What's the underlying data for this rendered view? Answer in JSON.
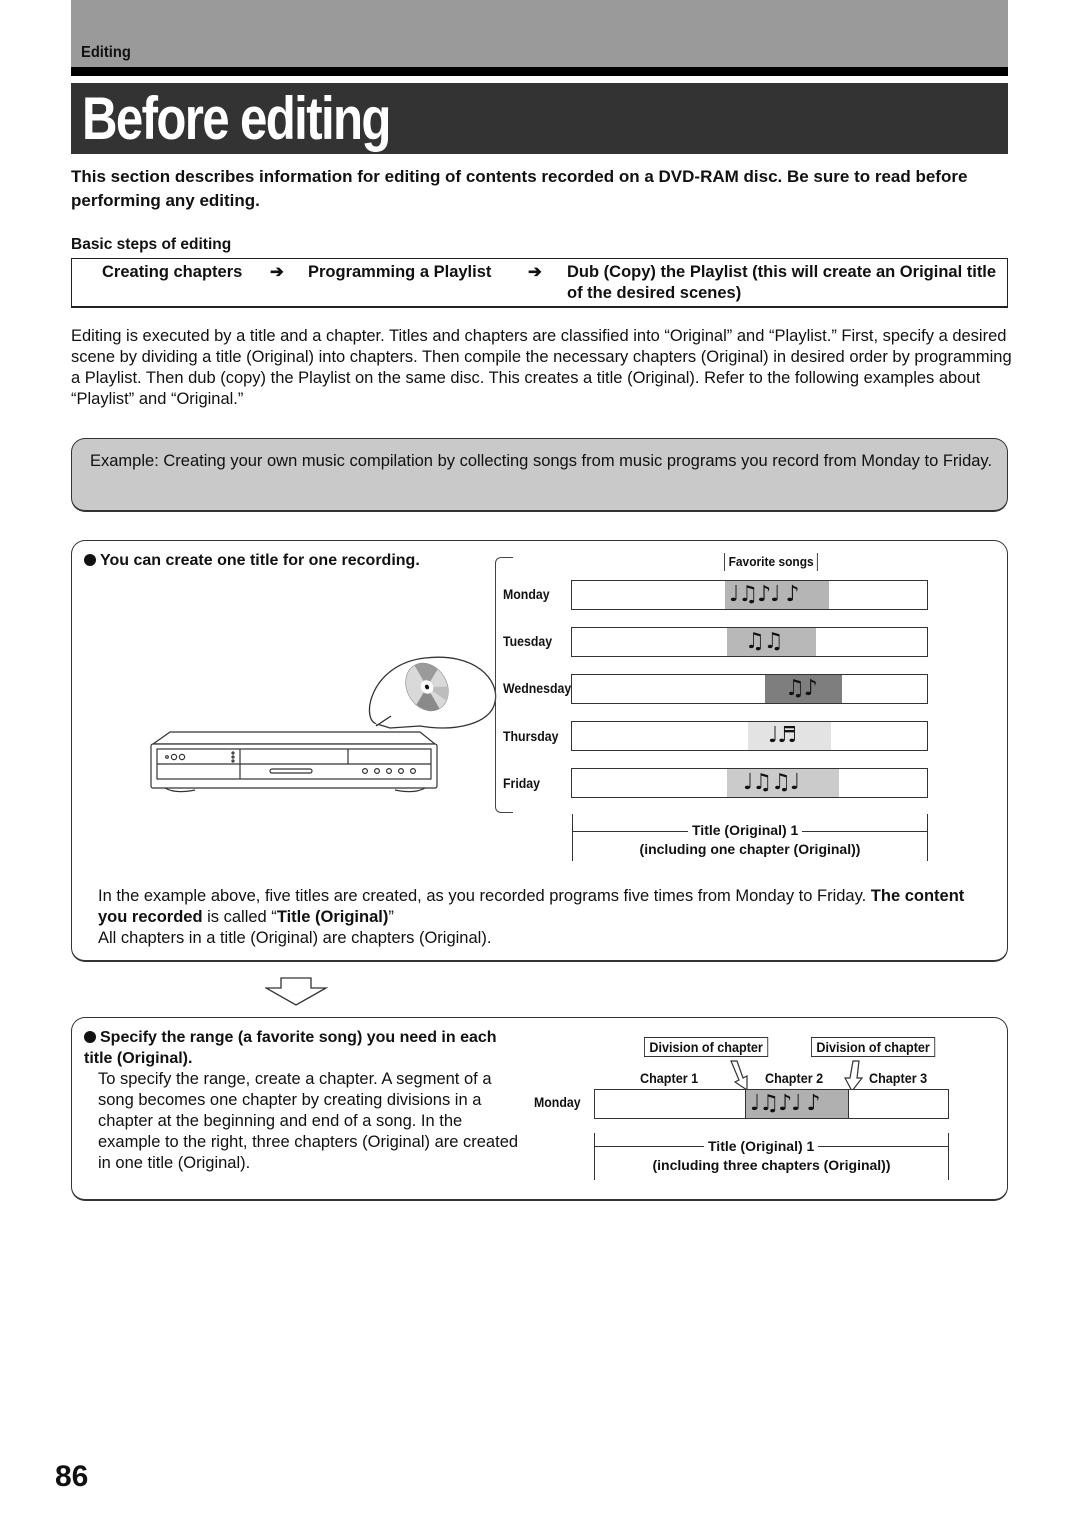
{
  "header": {
    "section": "Editing",
    "title": "Before editing"
  },
  "intro": "This section describes information for editing of contents recorded on a DVD-RAM disc. Be sure to read before performing any editing.",
  "basic_steps": {
    "heading": "Basic steps of editing",
    "steps": [
      "Creating chapters",
      "Programming a Playlist",
      "Dub (Copy) the Playlist (this will create an Original title of the desired scenes)"
    ],
    "arrow_glyph": "➔"
  },
  "body_paragraph": "Editing is executed by a title and a chapter. Titles and chapters are classified into “Original” and “Playlist.” First, specify a desired scene by dividing a title (Original) into chapters. Then compile the necessary chapters (Original) in desired order by programming a Playlist. Then dub (copy) the Playlist on the same disc. This creates a title (Original). Refer to the following examples about “Playlist” and “Original.”",
  "example": "Example: Creating your own music compilation by collecting songs from music programs you record from Monday to Friday.",
  "panel1": {
    "heading": "You can create one title for one recording.",
    "favorite_label": "Favorite songs",
    "days": [
      {
        "label": "Monday",
        "notes": "♩♫♪♩ ♪",
        "shade": "#b5b5b5"
      },
      {
        "label": "Tuesday",
        "notes": "♫♫",
        "shade": "#b8b8b8"
      },
      {
        "label": "Wednesday",
        "notes": "♫♪",
        "shade": "#7e7e7e"
      },
      {
        "label": "Thursday",
        "notes": "♩♬",
        "shade": "#e3e3e3"
      },
      {
        "label": "Friday",
        "notes": "♩♫♫♩",
        "shade": "#cbcbcb"
      }
    ],
    "span_title": "Title (Original) 1",
    "span_subtitle": "(including one chapter (Original))",
    "para_part1": "In the example above, five titles are created, as you recorded programs five times from Monday to Friday. ",
    "para_bold1": "The content you recorded",
    "para_part2": " is called “",
    "para_bold2": "Title (Original)",
    "para_part3": "”",
    "para_line2": "All chapters in a title (Original) are chapters (Original)."
  },
  "panel2": {
    "heading": "Specify the range (a favorite song) you need in each title (Original).",
    "paragraph": "To specify the range, create a chapter. A segment of a song becomes one chapter by creating divisions in a chapter at the beginning and end of a song. In the example to the right, three chapters (Original) are created in one title (Original).",
    "division_label": "Division of chapter",
    "chapters": [
      "Chapter 1",
      "Chapter 2",
      "Chapter 3"
    ],
    "day_label": "Monday",
    "notes": "♩♫♪♩ ♪",
    "span_title": "Title (Original) 1",
    "span_subtitle": "(including three chapters (Original))"
  },
  "page_number": "86"
}
